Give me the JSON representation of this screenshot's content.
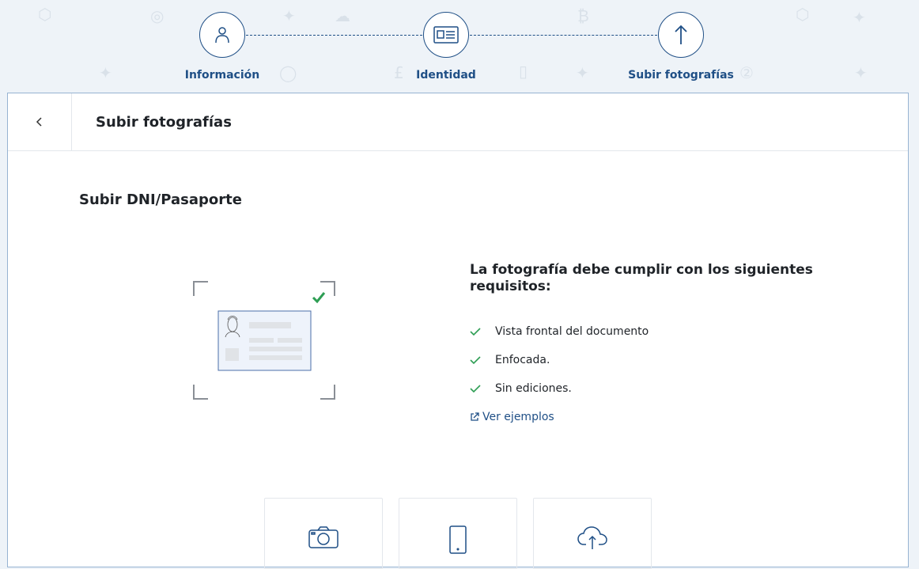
{
  "colors": {
    "primary": "#1f4f86",
    "check": "#2e9e54",
    "border": "#97b3d2"
  },
  "stepper": {
    "steps": [
      {
        "label": "Información",
        "icon": "person-icon"
      },
      {
        "label": "Identidad",
        "icon": "id-card-icon"
      },
      {
        "label": "Subir fotografías",
        "icon": "arrow-up-icon"
      }
    ]
  },
  "card": {
    "back_icon": "chevron-left-icon",
    "title": "Subir fotografías",
    "section_title": "Subir DNI/Pasaporte",
    "requirements": {
      "title": "La fotografía debe cumplir con los siguientes requisitos:",
      "items": [
        "Vista frontal del documento",
        "Enfocada.",
        "Sin ediciones."
      ],
      "examples_label": "Ver ejemplos"
    },
    "upload_options": [
      {
        "icon": "camera-icon"
      },
      {
        "icon": "smartphone-icon"
      },
      {
        "icon": "cloud-upload-icon"
      }
    ]
  }
}
